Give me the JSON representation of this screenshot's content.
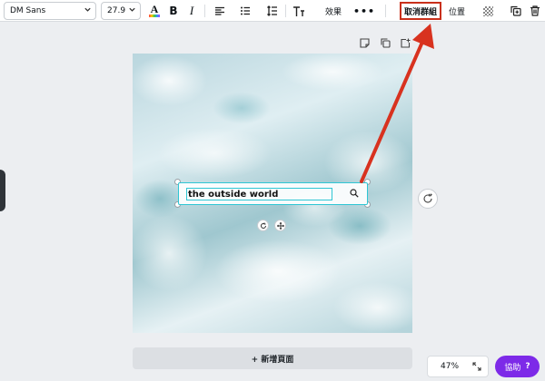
{
  "toolbar": {
    "font_family": "DM Sans",
    "font_size": "27.9",
    "effects_label": "效果",
    "more_label": "•••",
    "ungroup_label": "取消群組",
    "position_label": "位置"
  },
  "canvas": {
    "text_content": "the outside world"
  },
  "bottom": {
    "add_page_label": "+ 新增頁面",
    "zoom_level": "47%",
    "help_label": "協助",
    "help_icon": "?"
  },
  "colors": {
    "accent_purple": "#7d2ae8",
    "annotation_red": "#c9301b",
    "selection_cyan": "#2fc6d4"
  },
  "icons": {
    "font_dropdown": "chevron-down-icon",
    "size_dropdown": "chevron-down-icon",
    "text_color": "text-color-icon",
    "bold": "bold-icon",
    "italic": "italic-icon",
    "align": "align-left-icon",
    "list": "list-icon",
    "spacing": "line-spacing-icon",
    "text_size": "text-size-icon",
    "transparency": "transparency-icon",
    "duplicate": "duplicate-icon",
    "delete": "trash-icon",
    "note": "note-icon",
    "copy_page": "copy-page-icon",
    "add_page": "add-page-icon",
    "search": "search-icon",
    "rotate": "rotate-icon",
    "move": "move-icon",
    "refresh": "refresh-icon",
    "expand": "expand-icon"
  }
}
